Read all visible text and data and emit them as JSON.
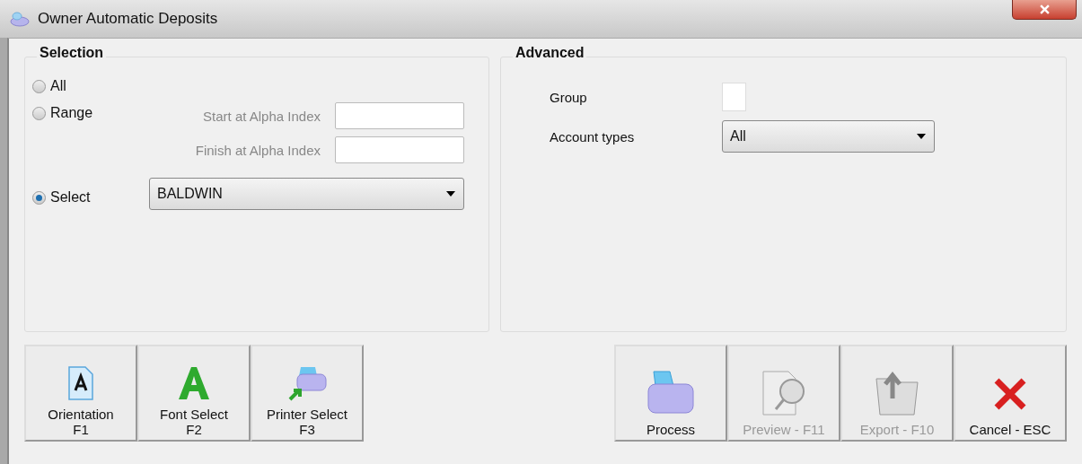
{
  "window": {
    "title": "Owner Automatic Deposits"
  },
  "selection": {
    "title": "Selection",
    "options": [
      {
        "label": "All",
        "selected": false
      },
      {
        "label": "Range",
        "selected": false
      },
      {
        "label": "Select",
        "selected": true
      }
    ],
    "range_fields": [
      {
        "label": "Start at Alpha Index"
      },
      {
        "label": "Finish at Alpha Index"
      }
    ],
    "select_dropdown": {
      "value": "BALDWIN"
    }
  },
  "advanced": {
    "title": "Advanced",
    "group": {
      "label": "Group",
      "checked": false
    },
    "account_types": {
      "label": "Account types",
      "value": "All"
    }
  },
  "left_buttons": [
    {
      "kind": "orientation",
      "label": "Orientation",
      "key": "F1",
      "disabled": false
    },
    {
      "kind": "font",
      "label": "Font Select",
      "key": "F2",
      "disabled": false
    },
    {
      "kind": "printer-select",
      "label": "Printer Select",
      "key": "F3",
      "disabled": false
    }
  ],
  "right_buttons": [
    {
      "kind": "process",
      "label": "Process",
      "disabled": false
    },
    {
      "kind": "preview",
      "label": "Preview - F11",
      "disabled": true
    },
    {
      "kind": "export",
      "label": "Export - F10",
      "disabled": true
    },
    {
      "kind": "cancel",
      "label": "Cancel - ESC",
      "disabled": false
    }
  ]
}
